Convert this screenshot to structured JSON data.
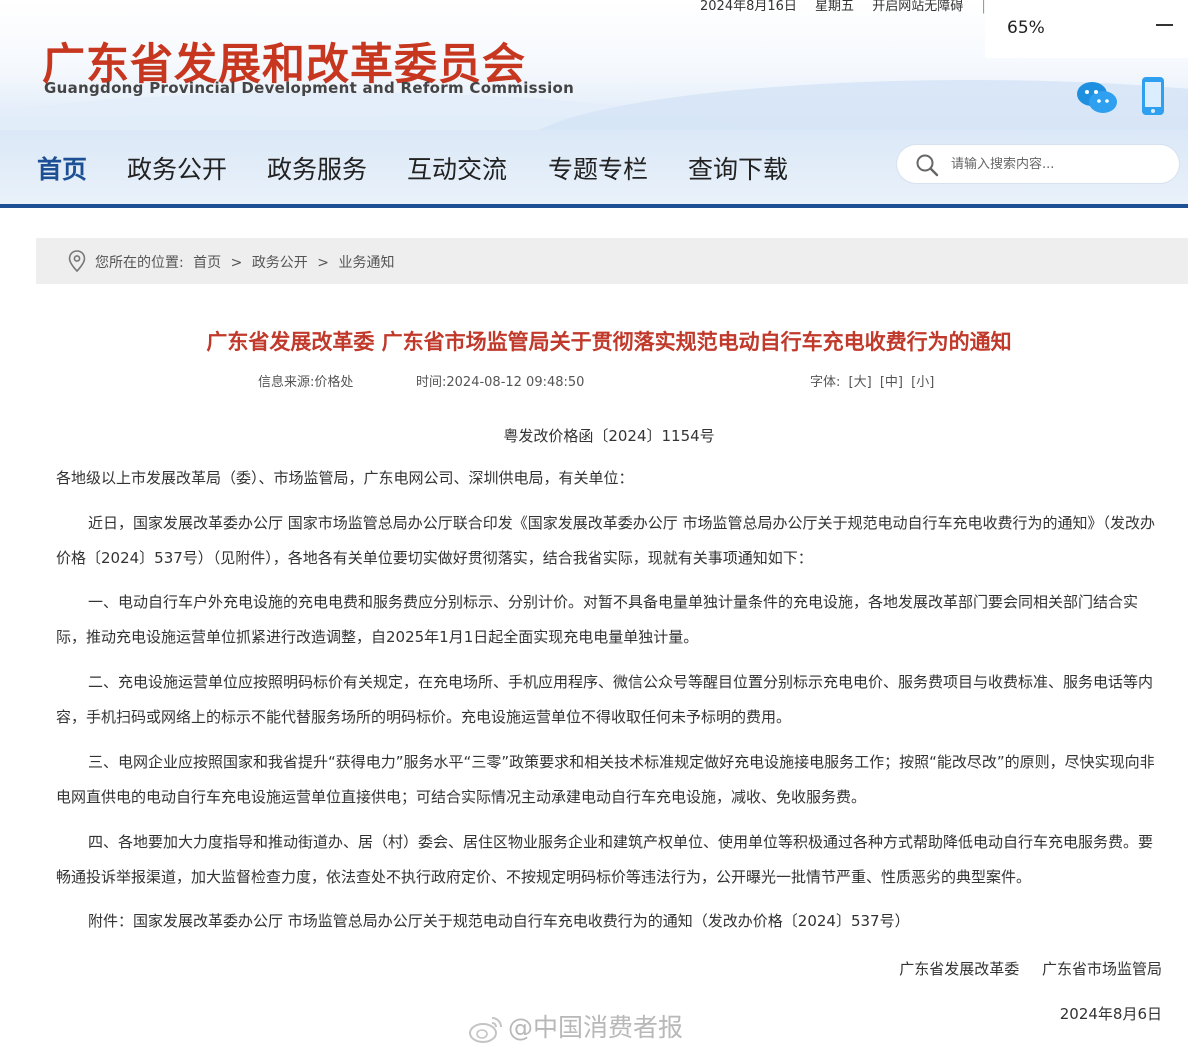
{
  "topbar": {
    "date": "2024年8月16日",
    "weekday": "星期五",
    "accessibility": "开启网站无障碍",
    "separator": "|"
  },
  "zoom": {
    "value": "65%"
  },
  "logo": {
    "cn": "广东省发展和改革委员会",
    "en": "Guangdong Provincial Development and Reform Commission"
  },
  "nav": {
    "items": [
      "首页",
      "政务公开",
      "政务服务",
      "互动交流",
      "专题专栏",
      "查询下载"
    ],
    "active_index": 0,
    "search_placeholder": "请输入搜索内容..."
  },
  "breadcrumb": {
    "prefix": "您所在的位置:",
    "items": [
      "首页",
      "政务公开",
      "业务通知"
    ],
    "separator": ">"
  },
  "article": {
    "title": "广东省发展改革委 广东省市场监管局关于贯彻落实规范电动自行车充电收费行为的通知",
    "source": "信息来源:价格处",
    "time": "时间:2024-08-12 09:48:50",
    "font_label": "字体:",
    "font_sizes": [
      "[大]",
      "[中]",
      "[小]"
    ],
    "doc_number": "粤发改价格函〔2024〕1154号",
    "addressee": "各地级以上市发展改革局（委）、市场监管局，广东电网公司、深圳供电局，有关单位：",
    "paragraphs": [
      "近日，国家发展改革委办公厅 国家市场监管总局办公厅联合印发《国家发展改革委办公厅 市场监管总局办公厅关于规范电动自行车充电收费行为的通知》（发改办价格〔2024〕537号）（见附件），各地各有关单位要切实做好贯彻落实，结合我省实际，现就有关事项通知如下：",
      "一、电动自行车户外充电设施的充电电费和服务费应分别标示、分别计价。对暂不具备电量单独计量条件的充电设施，各地发展改革部门要会同相关部门结合实际，推动充电设施运营单位抓紧进行改造调整，自2025年1月1日起全面实现充电电量单独计量。",
      "二、充电设施运营单位应按照明码标价有关规定，在充电场所、手机应用程序、微信公众号等醒目位置分别标示充电电价、服务费项目与收费标准、服务电话等内容，手机扫码或网络上的标示不能代替服务场所的明码标价。充电设施运营单位不得收取任何未予标明的费用。",
      "三、电网企业应按照国家和我省提升“获得电力”服务水平“三零”政策要求和相关技术标准规定做好充电设施接电服务工作；按照“能改尽改”的原则，尽快实现向非电网直供电的电动自行车充电设施运营单位直接供电；可结合实际情况主动承建电动自行车充电设施，减收、免收服务费。",
      "四、各地要加大力度指导和推动街道办、居（村）委会、居住区物业服务企业和建筑产权单位、使用单位等积极通过各种方式帮助降低电动自行车充电服务费。要畅通投诉举报渠道，加大监督检查力度，依法查处不执行政府定价、不按规定明码标价等违法行为，公开曝光一批情节严重、性质恶劣的典型案件。",
      "附件：国家发展改革委办公厅 市场监管总局办公厅关于规范电动自行车充电收费行为的通知（发改办价格〔2024〕537号）"
    ],
    "signers": [
      "广东省发展改革委",
      "广东省市场监管局"
    ],
    "date": "2024年8月6日"
  },
  "watermark": "@中国消费者报",
  "colors": {
    "brand_red": "#c7371f",
    "title_red": "#c0392b",
    "nav_blue": "#1d4f94"
  }
}
